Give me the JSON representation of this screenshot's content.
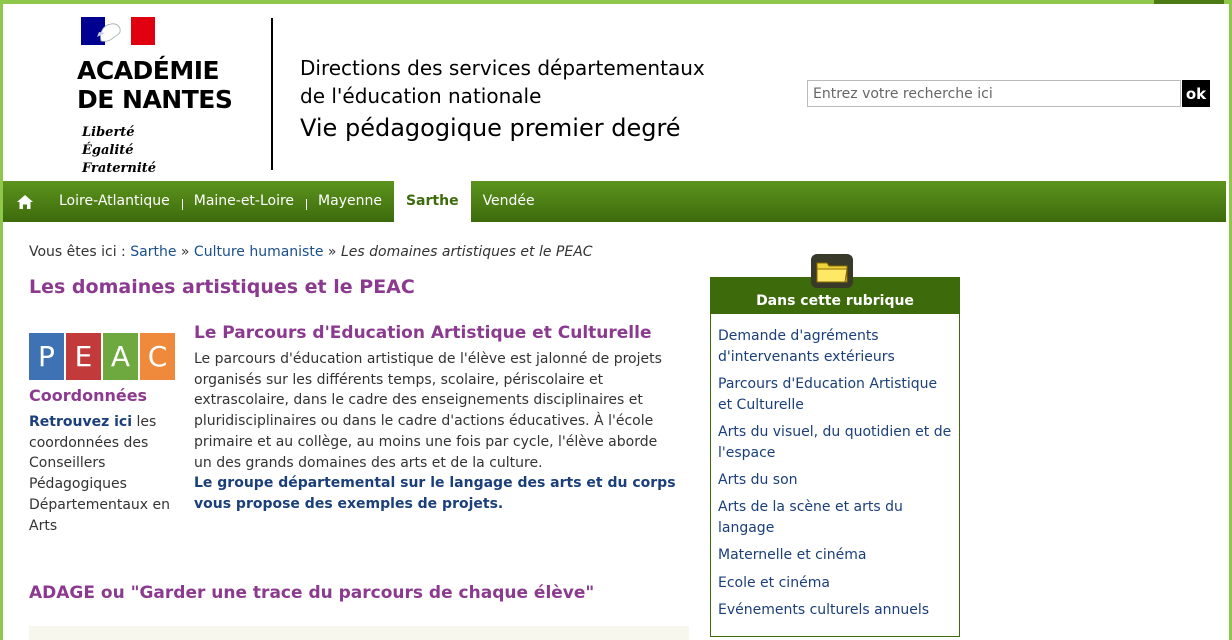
{
  "header": {
    "academy_name_line1": "ACADÉMIE",
    "academy_name_line2": "DE NANTES",
    "motto_line1": "Liberté",
    "motto_line2": "Égalité",
    "motto_line3": "Fraternité",
    "title_line1": "Directions des services départementaux",
    "title_line2": "de l'éducation nationale",
    "title_line3": "Vie pédagogique premier degré",
    "search_placeholder": "Entrez votre recherche ici",
    "search_button": "ok"
  },
  "nav": {
    "home_icon": "home-icon",
    "items": [
      "Loire-Atlantique",
      "Maine-et-Loire",
      "Mayenne",
      "Sarthe",
      "Vendée"
    ],
    "active": "Sarthe"
  },
  "breadcrumb": {
    "prefix": "Vous êtes ici :",
    "crumb1": "Sarthe",
    "sep1": "»",
    "crumb2": "Culture humaniste",
    "sep2": "»",
    "current": "Les domaines artistiques et le PEAC"
  },
  "main": {
    "page_title": "Les domaines artistiques et le PEAC",
    "peac_letters": [
      "P",
      "E",
      "A",
      "C"
    ],
    "peac_colors": [
      "#3f72b5",
      "#c23b3a",
      "#6ea93f",
      "#ef8a3d"
    ],
    "coord_title": "Coordonnées",
    "coord_link": "Retrouvez ici",
    "coord_text": "les coordonnées des Conseillers Pédagogiques Départementaux en Arts",
    "parcours_title": "Le Parcours d'Education Artistique et Culturelle",
    "parcours_text": "Le parcours d'éducation artistique de l'élève est jalonné de projets organisés sur les différents temps, scolaire, périscolaire et extrascolaire, dans le cadre des enseignements disciplinaires et pluridisciplinaires ou dans le cadre d'actions éducatives. À l'école primaire et au collège, au moins une fois par cycle, l'élève aborde un des grands domaines des arts et de la culture.",
    "parcours_link": "Le groupe départemental sur le langage des arts et du corps vous propose des exemples de projets.",
    "adage_title": "ADAGE ou \"Garder une trace du parcours de chaque élève\""
  },
  "sidebar": {
    "title": "Dans cette rubrique",
    "items": [
      "Demande d'agréments d'intervenants extérieurs",
      "Parcours d'Education Artistique et Culturelle",
      "Arts du visuel, du quotidien et de l'espace",
      "Arts du son",
      "Arts de la scène et arts du langage",
      "Maternelle et cinéma",
      "Ecole et cinéma",
      "Evénements culturels annuels"
    ]
  },
  "colors": {
    "accent_green": "#3d6b0c",
    "title_purple": "#8b3a8f",
    "link_blue": "#1a3f7a"
  }
}
